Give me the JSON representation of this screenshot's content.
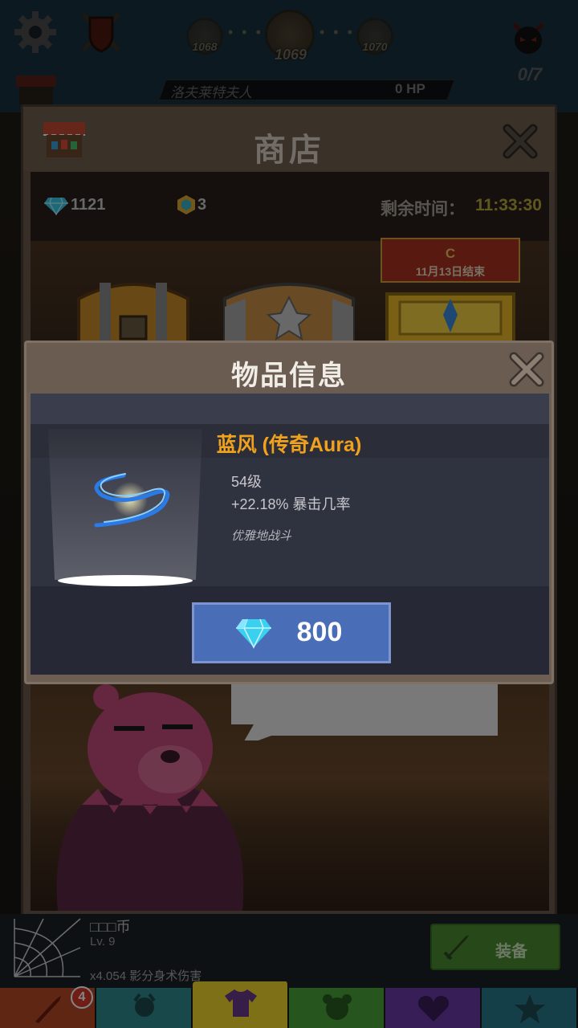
{
  "hud": {
    "stage_prev": "1068",
    "stage_current": "1069",
    "stage_next": "1070",
    "dots": "• • •",
    "kill_count": "0/7",
    "boss_name": "洛夫莱特夫人",
    "boss_hp": "0 HP"
  },
  "shop": {
    "title": "商店",
    "gems": "1121",
    "hex_tokens": "3",
    "timer_label": "剩余时间：",
    "timer_value": "11:33:30",
    "gold_chest_banner": {
      "letter": "C",
      "date": "11月13日结束"
    }
  },
  "equip_row": {
    "item_name": "□□□币",
    "item_level": "Lv. 9",
    "item_effect": "x4.054 影分身术伤害",
    "equip_label": "装备"
  },
  "tabs": {
    "badge_count": "4"
  },
  "modal": {
    "title": "物品信息",
    "item_title": "蓝风 (传奇Aura)",
    "required_level": "54级",
    "stat": "+22.18% 暴击几率",
    "flavor": "优雅地战斗",
    "price": "800"
  },
  "colors": {
    "legendary": "#f0a21e",
    "buy_button": "#4a6db8",
    "timer": "#b9a83c",
    "equip_button": "#4c8a2e"
  },
  "icons": [
    "gear-icon",
    "shield-icon",
    "demon-icon",
    "shop-icon",
    "close-icon",
    "gem-icon",
    "hex-token-icon",
    "chest-icon",
    "swirl-aura-icon",
    "sword-icon",
    "shirt-icon",
    "web-icon"
  ]
}
